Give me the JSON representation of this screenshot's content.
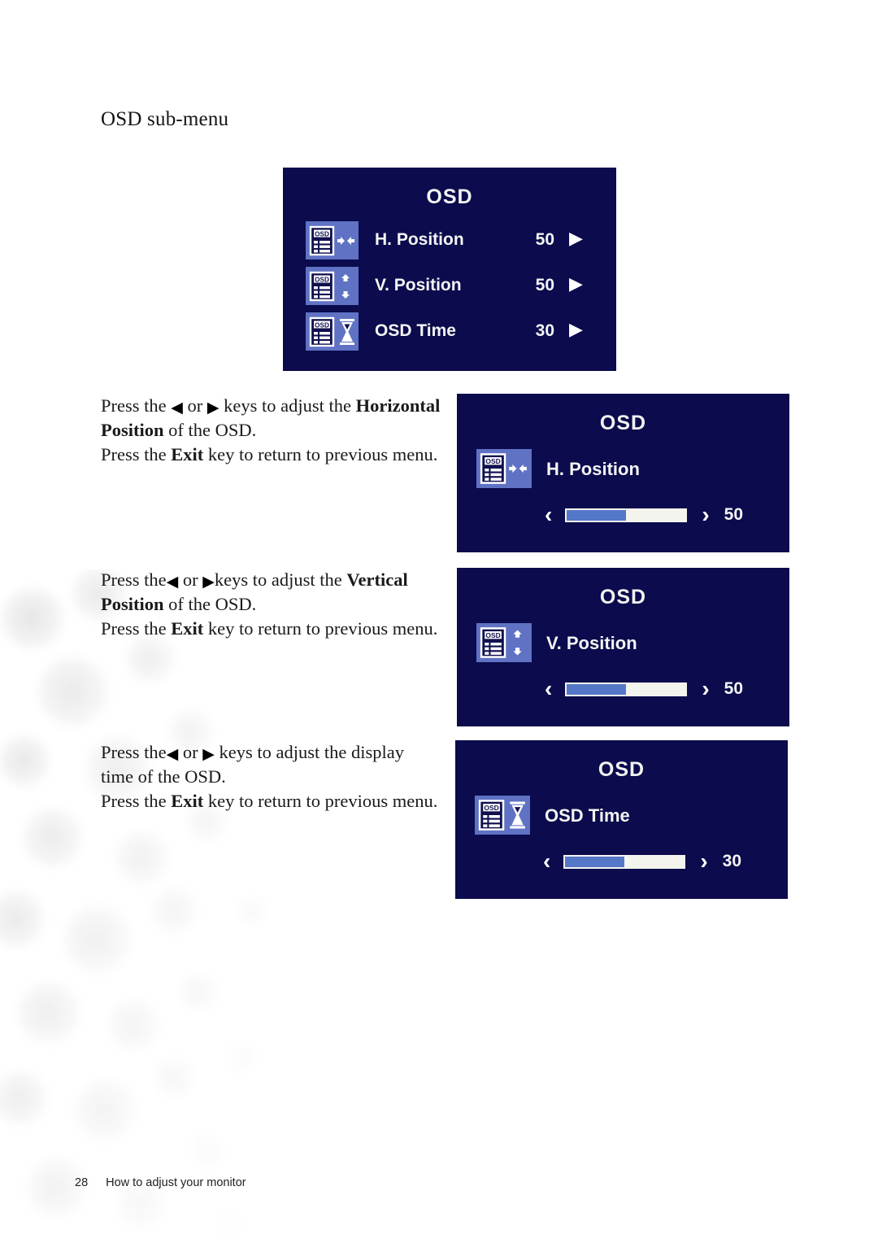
{
  "page": {
    "heading": "OSD sub-menu",
    "footer_page_number": "28",
    "footer_section": "How to adjust your monitor"
  },
  "colors": {
    "panel_background": "#0b0b4d",
    "icon_tile": "#5f72c4",
    "slider_fill": "#5577c8",
    "slider_track": "#f4f4ef",
    "text": "#f4f4f4"
  },
  "main_menu": {
    "title": "OSD",
    "rows": [
      {
        "icon": "osd-horizontal-position-icon",
        "label": "H. Position",
        "value": "50",
        "arrow": "▶"
      },
      {
        "icon": "osd-vertical-position-icon",
        "label": "V. Position",
        "value": "50",
        "arrow": "▶"
      },
      {
        "icon": "osd-time-icon",
        "label": "OSD Time",
        "value": "30",
        "arrow": "▶"
      }
    ]
  },
  "sections": [
    {
      "instruction": {
        "line1_a": "Press the ",
        "line1_left_key": "◀",
        "line1_b": " or ",
        "line1_right_key": "▶",
        "line1_c": " keys to adjust the ",
        "line1_bold": "Horizontal",
        "line2_bold": "Position",
        "line2_rest": " of the OSD.",
        "line3_a": "Press the ",
        "line3_bold": "Exit",
        "line3_b": " key to return to previous menu."
      },
      "panel": {
        "title": "OSD",
        "icon": "osd-horizontal-position-icon",
        "label": "H. Position",
        "value": "50",
        "fill_percent": 50,
        "left_chevron": "‹",
        "right_chevron": "›"
      }
    },
    {
      "instruction": {
        "line1_a": "Press the",
        "line1_left_key": "◀",
        "line1_b": " or ",
        "line1_right_key": "▶",
        "line1_c": "keys to adjust the ",
        "line1_bold": "Vertical",
        "line2_bold": "Position",
        "line2_rest": " of the OSD.",
        "line3_a": "Press the ",
        "line3_bold": "Exit",
        "line3_b": " key to return to previous menu."
      },
      "panel": {
        "title": "OSD",
        "icon": "osd-vertical-position-icon",
        "label": "V. Position",
        "value": "50",
        "fill_percent": 50,
        "left_chevron": "‹",
        "right_chevron": "›"
      }
    },
    {
      "instruction": {
        "line1_a": "Press the",
        "line1_left_key": "◀",
        "line1_b": " or ",
        "line1_right_key": "▶",
        "line1_c": " keys to adjust the display",
        "line1_bold": "",
        "line2_bold": "",
        "line2_rest": "time of the OSD.",
        "line3_a": "Press the ",
        "line3_bold": "Exit",
        "line3_b": " key to return to previous menu."
      },
      "panel": {
        "title": "OSD",
        "icon": "osd-time-icon",
        "label": "OSD Time",
        "value": "30",
        "fill_percent": 50,
        "left_chevron": "‹",
        "right_chevron": "›"
      }
    }
  ]
}
